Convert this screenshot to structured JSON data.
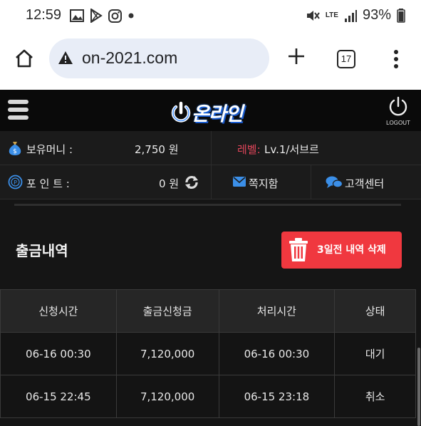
{
  "status_bar": {
    "time": "12:59",
    "battery": "93%",
    "network": "LTE"
  },
  "browser": {
    "url": "on-2021.com",
    "tab_count": "17"
  },
  "header": {
    "logo_text": "온라인",
    "logout_label": "LOGOUT"
  },
  "account": {
    "money_label": "보유머니 :",
    "money_value": "2,750 원",
    "level_label": "레벨:",
    "level_value": "Lv.1/서브르",
    "point_label": "포 인 트 :",
    "point_value": "0 원",
    "message_label": "쪽지함",
    "support_label": "고객센터"
  },
  "section": {
    "title": "출금내역",
    "delete_button": "3일전 내역 삭제"
  },
  "table": {
    "headers": [
      "신청시간",
      "출금신청금",
      "처리시간",
      "상태"
    ],
    "rows": [
      [
        "06-16 00:30",
        "7,120,000",
        "06-16 00:30",
        "대기"
      ],
      [
        "06-15 22:45",
        "7,120,000",
        "06-15 23:18",
        "취소"
      ]
    ]
  },
  "colors": {
    "accent_red": "#f0383f",
    "level_label": "#e0455a",
    "icon_blue": "#3b8fe8",
    "coin_gold": "#c9a04a"
  }
}
